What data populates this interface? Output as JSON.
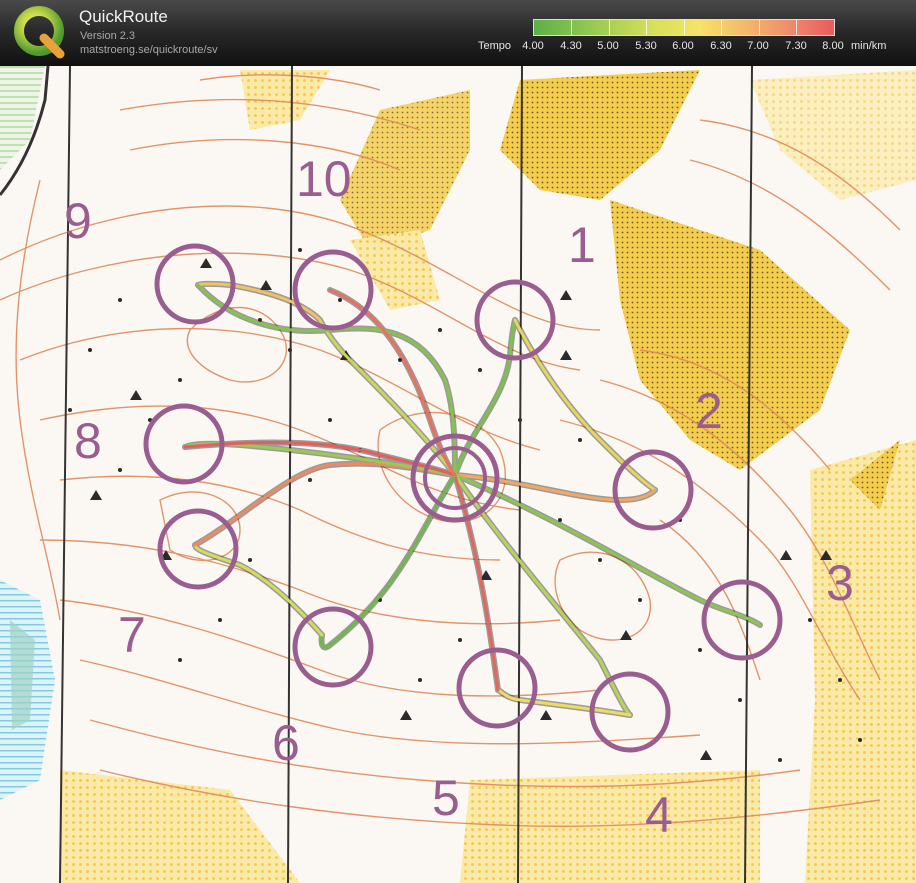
{
  "header": {
    "app_name": "QuickRoute",
    "version": "Version 2.3",
    "url": "matstroeng.se/quickroute/sv",
    "logo_letter": "Q",
    "tempo_label": "Tempo",
    "tempo_unit": "min/km",
    "tempo_values": [
      "4.00",
      "4.30",
      "5.00",
      "5.30",
      "6.00",
      "6.30",
      "7.00",
      "7.30",
      "8.00"
    ]
  },
  "map": {
    "controls": [
      {
        "label": "1"
      },
      {
        "label": "2"
      },
      {
        "label": "3"
      },
      {
        "label": "4"
      },
      {
        "label": "5"
      },
      {
        "label": "6"
      },
      {
        "label": "7"
      },
      {
        "label": "8"
      },
      {
        "label": "9"
      },
      {
        "label": "10"
      }
    ]
  },
  "colors": {
    "control_circle": "#9a5d8f",
    "contour": "#e08a5a",
    "open_land": "#f2c64a",
    "tempo_fast": "#5bb04a",
    "tempo_slow": "#ea5b5e"
  }
}
